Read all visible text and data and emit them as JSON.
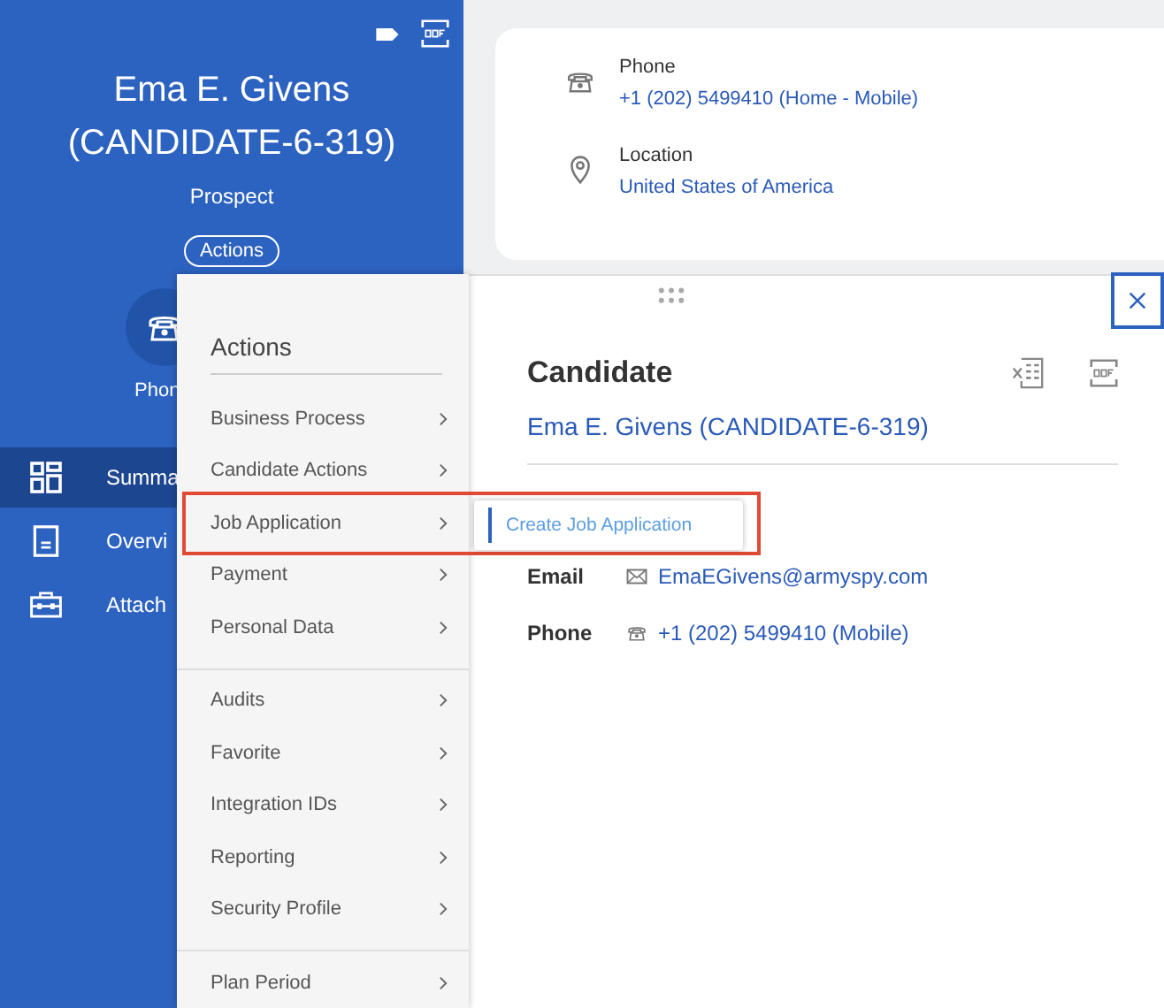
{
  "profile": {
    "name": "Ema E. Givens (CANDIDATE-6-319)",
    "status": "Prospect",
    "actions_button": "Actions",
    "quick_action": "Phon"
  },
  "nav": [
    {
      "kind": "grid",
      "label": "Summa",
      "selected": true
    },
    {
      "kind": "document",
      "label": "Overvi",
      "selected": false
    },
    {
      "kind": "briefcase",
      "label": "Attach",
      "selected": false
    }
  ],
  "contact_card": [
    {
      "kind": "phone",
      "label": "Phone",
      "value": "+1 (202) 5499410 (Home - Mobile)"
    },
    {
      "kind": "location",
      "label": "Location",
      "value": "United States of America"
    }
  ],
  "actions_menu": {
    "title": "Actions",
    "groups": [
      [
        {
          "label": "Business Process",
          "highlighted": false
        },
        {
          "label": "Candidate Actions",
          "highlighted": false
        },
        {
          "label": "Job Application",
          "highlighted": true,
          "submenu": [
            "Create Job Application"
          ]
        },
        {
          "label": "Payment",
          "highlighted": false
        },
        {
          "label": "Personal Data",
          "highlighted": false
        }
      ],
      [
        {
          "label": "Audits",
          "highlighted": false
        },
        {
          "label": "Favorite",
          "highlighted": false
        },
        {
          "label": "Integration IDs",
          "highlighted": false
        },
        {
          "label": "Reporting",
          "highlighted": false
        },
        {
          "label": "Security Profile",
          "highlighted": false
        }
      ],
      [
        {
          "label": "Plan Period",
          "highlighted": false
        }
      ]
    ]
  },
  "popup": {
    "title": "Candidate",
    "link": "Ema E. Givens (CANDIDATE-6-319)",
    "fields": [
      {
        "kind": "email",
        "label": "Email",
        "value": "EmaEGivens@armyspy.com"
      },
      {
        "kind": "phone",
        "label": "Phone",
        "value": "+1 (202) 5499410 (Mobile)"
      }
    ]
  }
}
